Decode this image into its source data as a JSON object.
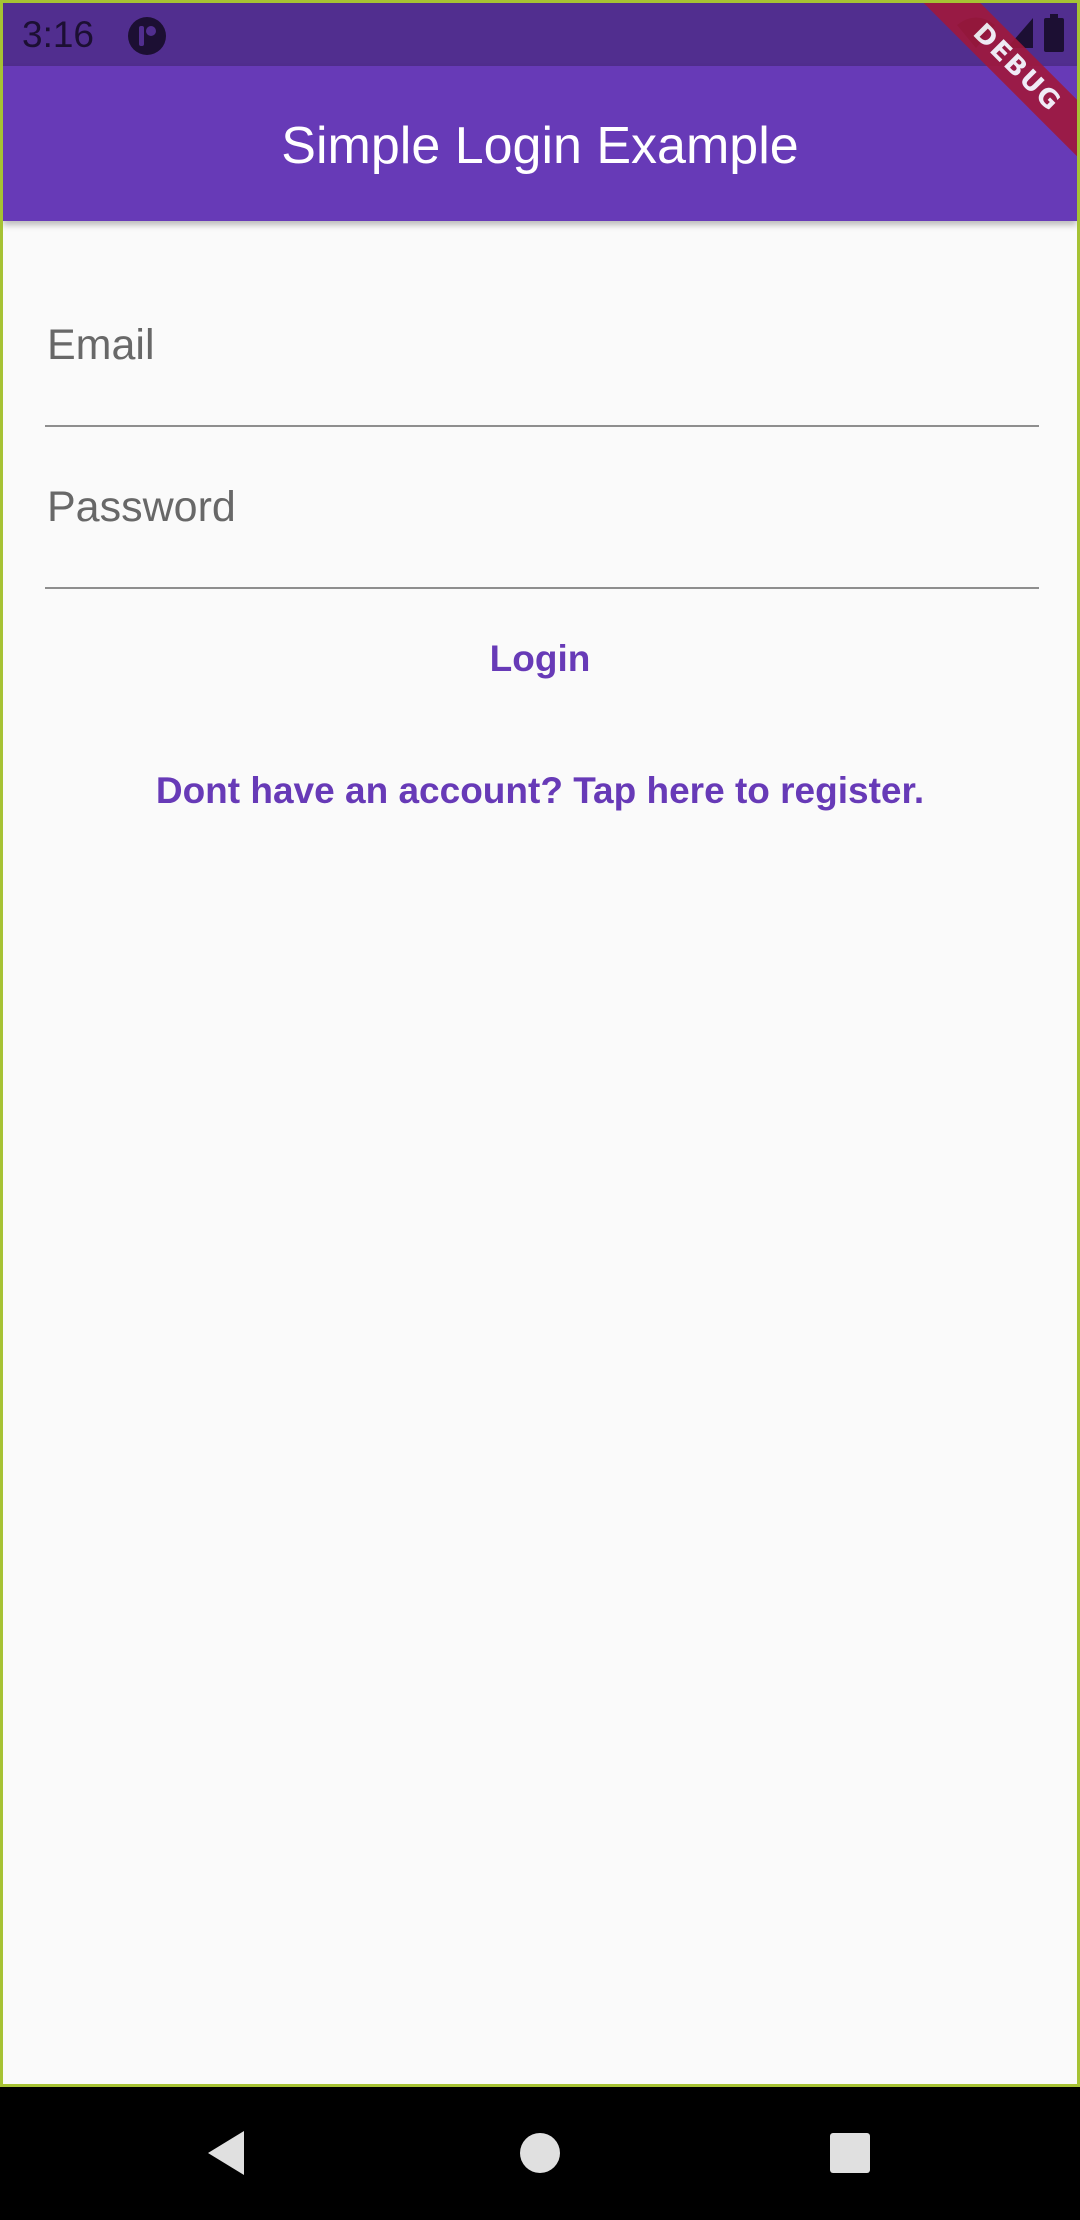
{
  "status_bar": {
    "time": "3:16"
  },
  "app_bar": {
    "title": "Simple Login Example"
  },
  "debug_banner": "DEBUG",
  "form": {
    "email_label": "Email",
    "password_label": "Password",
    "login_label": "Login",
    "register_label": "Dont have an account? Tap here to register."
  },
  "colors": {
    "primary": "#673ab7",
    "status_bar": "#512e8f",
    "background": "#fafafa",
    "debug_ribbon": "#a0183c"
  },
  "icons": {
    "status_left": "notification-icon",
    "status_right": [
      "wifi-icon",
      "cell-signal-icon",
      "battery-icon"
    ],
    "nav": [
      "back-icon",
      "home-icon",
      "recents-icon"
    ]
  }
}
